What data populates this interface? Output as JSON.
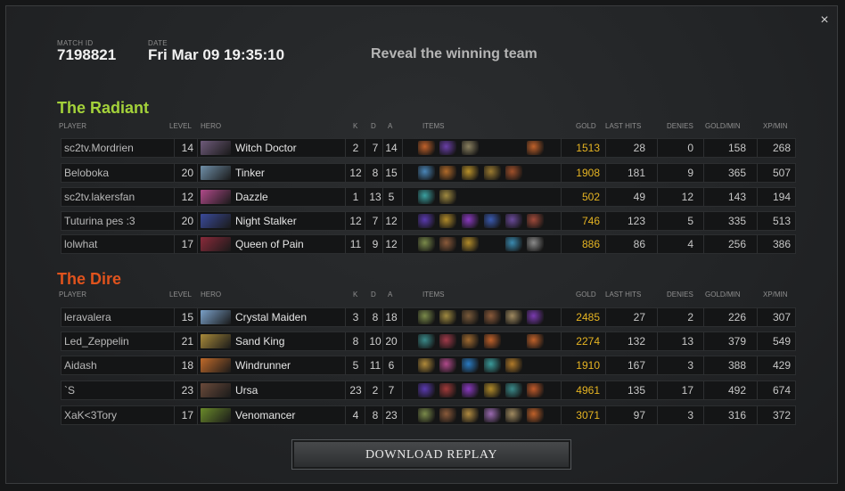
{
  "match": {
    "id_label": "MATCH ID",
    "id": "7198821",
    "date_label": "DATE",
    "date": "Fri Mar 09 19:35:10",
    "reveal": "Reveal the winning team",
    "close_icon": "×"
  },
  "columns": {
    "player": "PLAYER",
    "level": "LEVEL",
    "hero": "HERO",
    "k": "K",
    "d": "D",
    "a": "A",
    "items": "ITEMS",
    "gold": "GOLD",
    "last_hits": "LAST HITS",
    "denies": "DENIES",
    "gpm": "GOLD/MIN",
    "xpm": "XP/MIN"
  },
  "colors": {
    "radiant": "#a4d23a",
    "dire": "#e0531d",
    "gold": "#e6b422"
  },
  "radiant": {
    "title": "The Radiant",
    "players": [
      {
        "name": "sc2tv.Mordrien",
        "level": "14",
        "hero": "Witch Doctor",
        "k": "2",
        "d": "7",
        "a": "14",
        "gold": "1513",
        "lh": "28",
        "den": "0",
        "gpm": "158",
        "xpm": "268",
        "portrait": "#6e5a7a",
        "items": [
          "#c0612a",
          "#6a3fa8",
          "#8a8060",
          "",
          "",
          "#c0612a"
        ]
      },
      {
        "name": "Beloboka",
        "level": "20",
        "hero": "Tinker",
        "k": "12",
        "d": "8",
        "a": "15",
        "gold": "1908",
        "lh": "181",
        "den": "9",
        "gpm": "365",
        "xpm": "507",
        "portrait": "#6f8fa8",
        "items": [
          "#4a86b8",
          "#b06a2a",
          "#b8902a",
          "#9a7a30",
          "#a0502a",
          ""
        ]
      },
      {
        "name": "sc2tv.lakersfan",
        "level": "12",
        "hero": "Dazzle",
        "k": "1",
        "d": "13",
        "a": "5",
        "gold": "502",
        "lh": "49",
        "den": "12",
        "gpm": "143",
        "xpm": "194",
        "portrait": "#b04a8a",
        "items": [
          "#3aa0a0",
          "#a08a40",
          "",
          "",
          "",
          ""
        ]
      },
      {
        "name": "Tuturina pes :3",
        "level": "20",
        "hero": "Night Stalker",
        "k": "12",
        "d": "7",
        "a": "12",
        "gold": "746",
        "lh": "123",
        "den": "5",
        "gpm": "335",
        "xpm": "513",
        "portrait": "#3a4a9a",
        "items": [
          "#5a3ab0",
          "#b08a2a",
          "#8a3ac0",
          "#3a5ab0",
          "#6a4a9a",
          "#a04a3a"
        ]
      },
      {
        "name": "lolwhat",
        "level": "17",
        "hero": "Queen of Pain",
        "k": "11",
        "d": "9",
        "a": "12",
        "gold": "886",
        "lh": "86",
        "den": "4",
        "gpm": "256",
        "xpm": "386",
        "portrait": "#8a2a3a",
        "items": [
          "#7a8a4a",
          "#8a5a3a",
          "#b08a2a",
          "",
          "#3a8ab0",
          "#8a8a8a"
        ]
      }
    ]
  },
  "dire": {
    "title": "The Dire",
    "players": [
      {
        "name": "leravalera",
        "level": "15",
        "hero": "Crystal Maiden",
        "k": "3",
        "d": "8",
        "a": "18",
        "gold": "2485",
        "lh": "27",
        "den": "2",
        "gpm": "226",
        "xpm": "307",
        "portrait": "#7aa0c8",
        "items": [
          "#7a8a4a",
          "#a08a40",
          "#7a5a3a",
          "#8a5a3a",
          "#a08a60",
          "#7a3ab0"
        ]
      },
      {
        "name": "Led_Zeppelin",
        "level": "21",
        "hero": "Sand King",
        "k": "8",
        "d": "10",
        "a": "20",
        "gold": "2274",
        "lh": "132",
        "den": "13",
        "gpm": "379",
        "xpm": "549",
        "portrait": "#a88a3a",
        "items": [
          "#3a8a8a",
          "#a03a4a",
          "#a06a30",
          "#c0612a",
          "",
          "#c0612a"
        ]
      },
      {
        "name": "Aidash",
        "level": "18",
        "hero": "Windrunner",
        "k": "5",
        "d": "11",
        "a": "6",
        "gold": "1910",
        "lh": "167",
        "den": "3",
        "gpm": "388",
        "xpm": "429",
        "portrait": "#c06a2a",
        "items": [
          "#b08a3a",
          "#b04a8a",
          "#2a7ac0",
          "#3a9a9a",
          "#b07a2a",
          ""
        ]
      },
      {
        "name": "`S",
        "level": "23",
        "hero": "Ursa",
        "k": "23",
        "d": "2",
        "a": "7",
        "gold": "4961",
        "lh": "135",
        "den": "17",
        "gpm": "492",
        "xpm": "674",
        "portrait": "#6a4a3a",
        "items": [
          "#5a3ab0",
          "#a03a3a",
          "#8a3ac0",
          "#b08a2a",
          "#3a8a8a",
          "#c05a2a"
        ]
      },
      {
        "name": "XaK<3Tory",
        "level": "17",
        "hero": "Venomancer",
        "k": "4",
        "d": "8",
        "a": "23",
        "gold": "3071",
        "lh": "97",
        "den": "3",
        "gpm": "316",
        "xpm": "372",
        "portrait": "#6a8a2a",
        "items": [
          "#7a8a4a",
          "#8a5a3a",
          "#b08a40",
          "#9a6ab0",
          "#a08a60",
          "#c0612a"
        ]
      }
    ]
  },
  "download": "DOWNLOAD REPLAY"
}
